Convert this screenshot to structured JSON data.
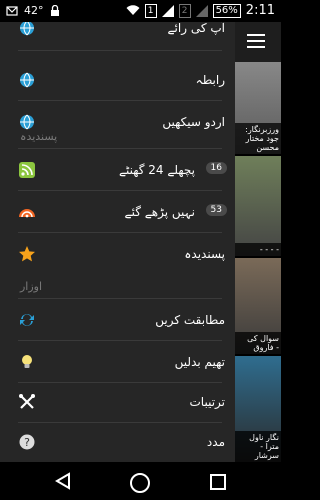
{
  "status_bar": {
    "signal_text": "42°",
    "sim1": "1",
    "sim2": "2",
    "battery": "56%",
    "time": "2:11"
  },
  "drawer": {
    "top_partial_label": "آپ کی رائے",
    "items_top": [
      {
        "label": "رابطہ",
        "icon": "globe-icon"
      },
      {
        "label": "اردو سیکھیں",
        "icon": "globe-icon"
      }
    ],
    "favorites_header": "پسندیدہ",
    "favorites": [
      {
        "label": "پچھلے 24 گھنٹے",
        "icon": "rss-icon",
        "badge": "16"
      },
      {
        "label": "نہیں پڑھے گئے",
        "icon": "rss-unread-icon",
        "badge": "53"
      },
      {
        "label": "پسندیدہ",
        "icon": "star-icon"
      }
    ],
    "tools_header": "اوزار",
    "tools": [
      {
        "label": "مطابقت کریں",
        "icon": "sync-icon"
      },
      {
        "label": "تھیم بدلیں",
        "icon": "bulb-icon"
      },
      {
        "label": "ترتیبات",
        "icon": "settings-tools-icon"
      },
      {
        "label": "مدد",
        "icon": "help-icon"
      }
    ]
  },
  "feed_thumbs": [
    {
      "caption_lines": [
        "ورزبرنگار:",
        "جود مختار",
        "محسن"
      ]
    },
    {
      "caption_lines": [
        "- - - -"
      ]
    },
    {
      "caption_lines": [
        "سوال کی",
        "- فاروق"
      ]
    },
    {
      "caption_lines": [
        "نگار ناول",
        "مترا -",
        "سرشار"
      ]
    }
  ]
}
